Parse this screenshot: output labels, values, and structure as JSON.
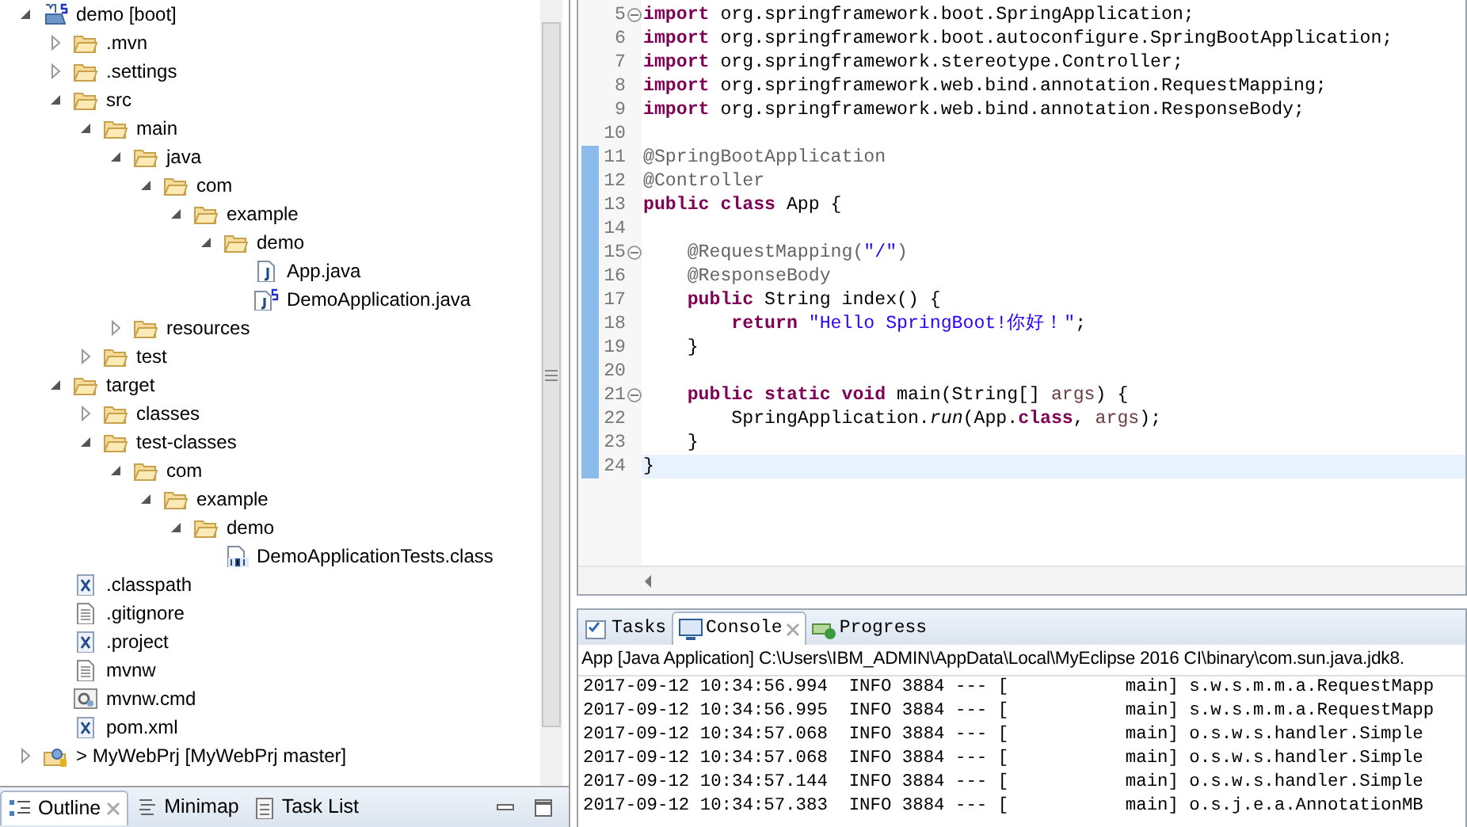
{
  "explorer": {
    "tree": [
      {
        "label": "demo [boot]",
        "kind": "maven-project",
        "expanded": true,
        "children": [
          {
            "label": ".mvn",
            "kind": "folder",
            "expanded": false
          },
          {
            "label": ".settings",
            "kind": "folder",
            "expanded": false
          },
          {
            "label": "src",
            "kind": "folder",
            "expanded": true,
            "children": [
              {
                "label": "main",
                "kind": "folder",
                "expanded": true,
                "children": [
                  {
                    "label": "java",
                    "kind": "folder",
                    "expanded": true,
                    "children": [
                      {
                        "label": "com",
                        "kind": "folder",
                        "expanded": true,
                        "children": [
                          {
                            "label": "example",
                            "kind": "folder",
                            "expanded": true,
                            "children": [
                              {
                                "label": "demo",
                                "kind": "folder",
                                "expanded": true,
                                "children": [
                                  {
                                    "label": "App.java",
                                    "kind": "java"
                                  },
                                  {
                                    "label": "DemoApplication.java",
                                    "kind": "java-spring"
                                  }
                                ]
                              }
                            ]
                          }
                        ]
                      }
                    ]
                  },
                  {
                    "label": "resources",
                    "kind": "folder",
                    "expanded": false
                  }
                ]
              },
              {
                "label": "test",
                "kind": "folder",
                "expanded": false
              }
            ]
          },
          {
            "label": "target",
            "kind": "folder",
            "expanded": true,
            "children": [
              {
                "label": "classes",
                "kind": "folder",
                "expanded": false
              },
              {
                "label": "test-classes",
                "kind": "folder",
                "expanded": true,
                "children": [
                  {
                    "label": "com",
                    "kind": "folder",
                    "expanded": true,
                    "children": [
                      {
                        "label": "example",
                        "kind": "folder",
                        "expanded": true,
                        "children": [
                          {
                            "label": "demo",
                            "kind": "folder",
                            "expanded": true,
                            "children": [
                              {
                                "label": "DemoApplicationTests.class",
                                "kind": "class"
                              }
                            ]
                          }
                        ]
                      }
                    ]
                  }
                ]
              }
            ]
          },
          {
            "label": ".classpath",
            "kind": "xml"
          },
          {
            "label": ".gitignore",
            "kind": "text"
          },
          {
            "label": ".project",
            "kind": "xml"
          },
          {
            "label": "mvnw",
            "kind": "text"
          },
          {
            "label": "mvnw.cmd",
            "kind": "cmd"
          },
          {
            "label": "pom.xml",
            "kind": "xml"
          }
        ]
      },
      {
        "label": "> MyWebPrj [MyWebPrj master]",
        "kind": "git-project",
        "expanded": false
      }
    ]
  },
  "bottom_tabs": [
    {
      "label": "Outline",
      "selected": true
    },
    {
      "label": "Minimap",
      "selected": false
    },
    {
      "label": "Task List",
      "selected": false
    }
  ],
  "editor": {
    "lines": [
      {
        "number": "5",
        "fold": true,
        "changed": false,
        "current": false,
        "tokens": [
          {
            "kind": "keyword",
            "text": "import"
          },
          {
            "kind": "plain",
            "text": " org.springframework.boot.SpringApplication;"
          }
        ]
      },
      {
        "number": "6",
        "fold": false,
        "changed": false,
        "current": false,
        "tokens": [
          {
            "kind": "keyword",
            "text": "import"
          },
          {
            "kind": "plain",
            "text": " org.springframework.boot.autoconfigure.SpringBootApplication;"
          }
        ]
      },
      {
        "number": "7",
        "fold": false,
        "changed": false,
        "current": false,
        "tokens": [
          {
            "kind": "keyword",
            "text": "import"
          },
          {
            "kind": "plain",
            "text": " org.springframework.stereotype.Controller;"
          }
        ]
      },
      {
        "number": "8",
        "fold": false,
        "changed": false,
        "current": false,
        "tokens": [
          {
            "kind": "keyword",
            "text": "import"
          },
          {
            "kind": "plain",
            "text": " org.springframework.web.bind.annotation.RequestMapping;"
          }
        ]
      },
      {
        "number": "9",
        "fold": false,
        "changed": false,
        "current": false,
        "tokens": [
          {
            "kind": "keyword",
            "text": "import"
          },
          {
            "kind": "plain",
            "text": " org.springframework.web.bind.annotation.ResponseBody;"
          }
        ]
      },
      {
        "number": "10",
        "fold": false,
        "changed": false,
        "current": false
      },
      {
        "number": "11",
        "fold": false,
        "changed": true,
        "current": false,
        "tokens": [
          {
            "kind": "annotation",
            "text": "@SpringBootApplication"
          }
        ]
      },
      {
        "number": "12",
        "fold": false,
        "changed": true,
        "current": false,
        "tokens": [
          {
            "kind": "annotation",
            "text": "@Controller"
          }
        ]
      },
      {
        "number": "13",
        "fold": false,
        "changed": true,
        "current": false,
        "tokens": [
          {
            "kind": "keyword",
            "text": "public class"
          },
          {
            "kind": "plain",
            "text": " App {"
          }
        ]
      },
      {
        "number": "14",
        "fold": false,
        "changed": true,
        "current": false
      },
      {
        "number": "15",
        "fold": true,
        "changed": true,
        "current": false,
        "tokens": [
          {
            "kind": "annotation",
            "text": "    @RequestMapping("
          },
          {
            "kind": "string",
            "text": "\"/\""
          },
          {
            "kind": "annotation",
            "text": ")"
          }
        ]
      },
      {
        "number": "16",
        "fold": false,
        "changed": true,
        "current": false,
        "tokens": [
          {
            "kind": "annotation",
            "text": "    @ResponseBody"
          }
        ]
      },
      {
        "number": "17",
        "fold": false,
        "changed": true,
        "current": false,
        "tokens": [
          {
            "kind": "keyword",
            "text": "    public"
          },
          {
            "kind": "plain",
            "text": " String index() {"
          }
        ]
      },
      {
        "number": "18",
        "fold": false,
        "changed": true,
        "current": false,
        "tokens": [
          {
            "kind": "keyword",
            "text": "        return"
          },
          {
            "kind": "string",
            "text": " \"Hello SpringBoot!你好！\""
          },
          {
            "kind": "plain",
            "text": ";"
          }
        ]
      },
      {
        "number": "19",
        "fold": false,
        "changed": true,
        "current": false,
        "tokens": [
          {
            "kind": "plain",
            "text": "    }"
          }
        ]
      },
      {
        "number": "20",
        "fold": false,
        "changed": true,
        "current": false
      },
      {
        "number": "21",
        "fold": true,
        "changed": true,
        "current": false,
        "tokens": [
          {
            "kind": "keyword",
            "text": "    public static void"
          },
          {
            "kind": "plain",
            "text": " main(String[] "
          },
          {
            "kind": "param",
            "text": "args"
          },
          {
            "kind": "plain",
            "text": ") {"
          }
        ]
      },
      {
        "number": "22",
        "fold": false,
        "changed": true,
        "current": false,
        "tokens": [
          {
            "kind": "plain",
            "text": "        SpringApplication."
          },
          {
            "kind": "static-call",
            "text": "run"
          },
          {
            "kind": "plain",
            "text": "(App."
          },
          {
            "kind": "keyword",
            "text": "class"
          },
          {
            "kind": "plain",
            "text": ", "
          },
          {
            "kind": "param",
            "text": "args"
          },
          {
            "kind": "plain",
            "text": ");"
          }
        ]
      },
      {
        "number": "23",
        "fold": false,
        "changed": true,
        "current": false,
        "tokens": [
          {
            "kind": "plain",
            "text": "    }"
          }
        ]
      },
      {
        "number": "24",
        "fold": false,
        "changed": true,
        "current": true,
        "tokens": [
          {
            "kind": "plain",
            "text": "}"
          }
        ]
      }
    ]
  },
  "console": {
    "tabs": [
      {
        "label": "Tasks",
        "selected": false
      },
      {
        "label": "Console",
        "selected": true
      },
      {
        "label": "Progress",
        "selected": false
      }
    ],
    "header": "App [Java Application] C:\\Users\\IBM_ADMIN\\AppData\\Local\\MyEclipse 2016 CI\\binary\\com.sun.java.jdk8.",
    "lines": [
      "2017-09-12 10:34:56.994  INFO 3884 --- [           main] s.w.s.m.m.a.RequestMapp",
      "2017-09-12 10:34:56.995  INFO 3884 --- [           main] s.w.s.m.m.a.RequestMapp",
      "2017-09-12 10:34:57.068  INFO 3884 --- [           main] o.s.w.s.handler.Simple",
      "2017-09-12 10:34:57.068  INFO 3884 --- [           main] o.s.w.s.handler.Simple",
      "2017-09-12 10:34:57.144  INFO 3884 --- [           main] o.s.w.s.handler.Simple",
      "2017-09-12 10:34:57.383  INFO 3884 --- [           main] o.s.j.e.a.AnnotationMB"
    ]
  }
}
